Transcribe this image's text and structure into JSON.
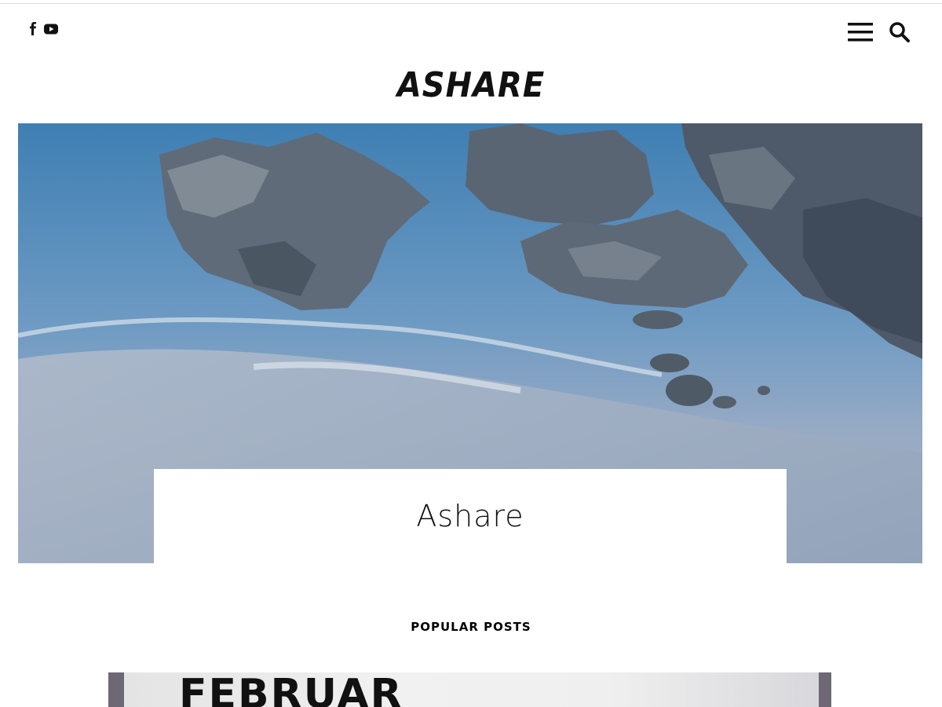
{
  "header": {
    "social": [
      {
        "name": "facebook-icon"
      },
      {
        "name": "youtube-icon"
      }
    ],
    "menu_icon": "hamburger-menu-icon",
    "search_icon": "search-icon"
  },
  "site": {
    "logo_text": "ASHARE"
  },
  "hero": {
    "image": "sea-rocks-beach-photo",
    "title": "Ashare"
  },
  "popular": {
    "heading": "POPULAR POSTS",
    "first_post_image_text": "FEBRUAR"
  },
  "colors": {
    "sea": "#4d86b4",
    "rock": "#5a6471",
    "sand": "#a9b6c6",
    "text": "#111111"
  }
}
